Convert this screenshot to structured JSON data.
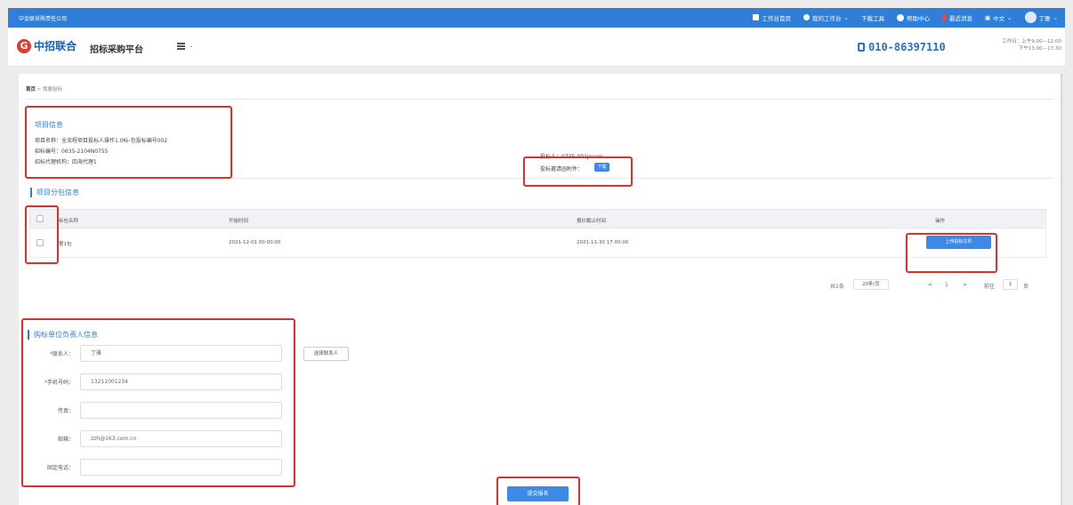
{
  "topbar": {
    "company": "中金联采购责任公司",
    "nav": [
      {
        "label": "工作台首页"
      },
      {
        "label": "我的工作台"
      },
      {
        "label": "下载工具"
      },
      {
        "label": "帮助中心"
      },
      {
        "label": "最近消息"
      },
      {
        "label": "中文"
      },
      {
        "label": "丁雅"
      }
    ]
  },
  "header": {
    "logo_text": "中招联合",
    "platform": "招标采购平台",
    "phone": "010-86397110",
    "hours_line1": "工作日：上午9:00—12:00",
    "hours_line2": "下午13:00—17:30"
  },
  "breadcrumb": {
    "home": "首页",
    "current": "我要投标"
  },
  "project": {
    "title": "项目信息",
    "name_label": "项目名称：",
    "name_value": "全流程项目投标人操作1.0标-包投标编号002",
    "code_label": "招标编号：",
    "code_value": "0635-2104N0755",
    "agency_label": "招标代理机构：",
    "agency_value": "四海代理1",
    "bidder_label": "投标人：",
    "bidder_value": "0735-001Jeccm",
    "file_label": "投标邀请函附件：",
    "file_button": "下载"
  },
  "package": {
    "title": "项目分包信息",
    "columns": [
      "标包名称",
      "开始时间",
      "报价截止时间",
      "操作"
    ],
    "rows": [
      {
        "name": "第1包",
        "start": "2021-12-01 00:00:00",
        "deadline": "2021-11-30 17:00:00",
        "action": "上传投标文件"
      }
    ]
  },
  "pagination": {
    "total": "共1条",
    "page_size": "20条/页",
    "prev": "<",
    "page": "1",
    "next": ">",
    "goto_label": "前往",
    "goto_value": "1",
    "page_unit": "页"
  },
  "contact": {
    "title": "购标单位负责人信息",
    "fields": [
      {
        "label": "联系人：",
        "required": true,
        "value": "丁雅"
      },
      {
        "label": "手机号码：",
        "required": true,
        "value": "13211001234"
      },
      {
        "label": "传真：",
        "required": false,
        "value": ""
      },
      {
        "label": "邮箱：",
        "required": false,
        "value": "zzh@163.com.cn"
      },
      {
        "label": "固定电话：",
        "required": false,
        "value": ""
      }
    ],
    "select_button": "选择联系人"
  },
  "submit_button": "提交报名",
  "colors": {
    "primary": "#2f7fd8",
    "highlight": "#d9312b"
  }
}
